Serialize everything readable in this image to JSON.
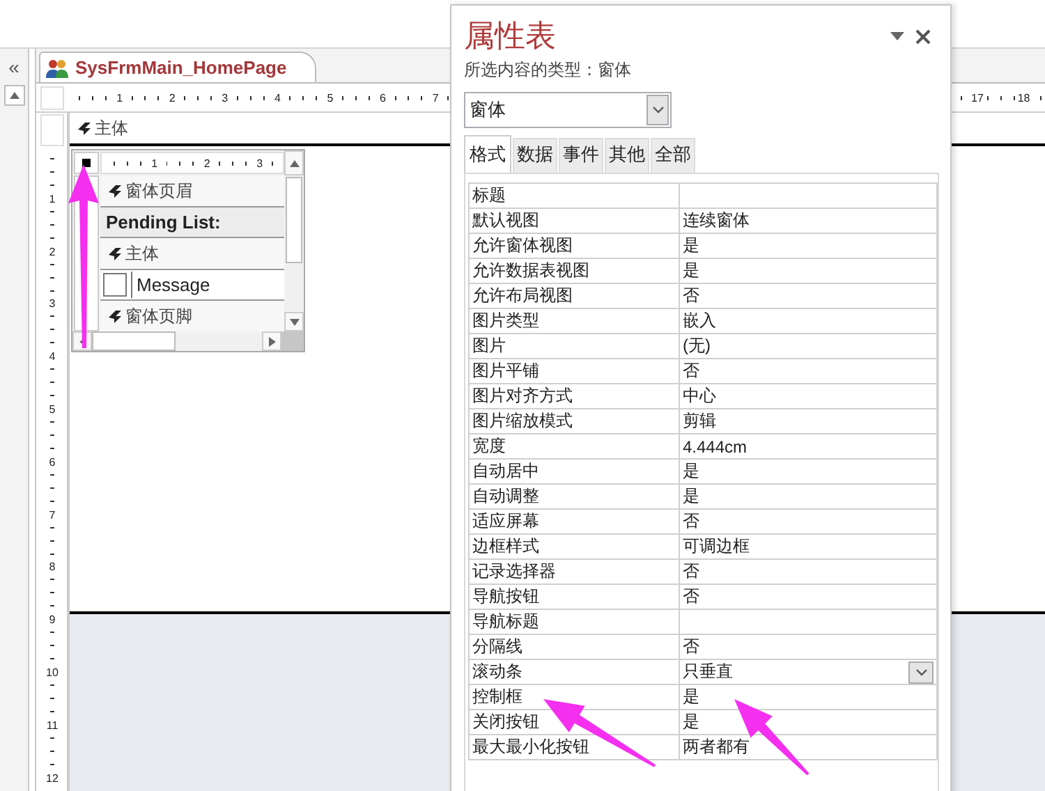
{
  "navigation_pane": {
    "collapse_glyph": "«"
  },
  "document_tab": {
    "title": "SysFrmMain_HomePage",
    "selected": true
  },
  "ruler": {
    "left_labels": [
      "1",
      "2",
      "3",
      "4",
      "5",
      "6",
      "7"
    ],
    "right_labels": [
      "17",
      "18"
    ]
  },
  "vertical_ruler": {
    "labels": [
      "1",
      "2",
      "3",
      "4",
      "5",
      "6",
      "7",
      "8",
      "9",
      "10",
      "11",
      "12"
    ]
  },
  "section": {
    "title": "主体"
  },
  "subform": {
    "ruler_labels": [
      "1",
      "2",
      "3"
    ],
    "sections": [
      {
        "kind": "header",
        "text": "窗体页眉"
      },
      {
        "kind": "label",
        "text": "Pending List:"
      },
      {
        "kind": "header",
        "text": "主体"
      },
      {
        "kind": "field",
        "text": "Message",
        "checked": false
      },
      {
        "kind": "header",
        "text": "窗体页脚"
      }
    ]
  },
  "property_sheet": {
    "title": "属性表",
    "selection_type": "所选内容的类型：窗体",
    "selector": {
      "value": "窗体"
    },
    "tabs": [
      {
        "label": "格式",
        "selected": true
      },
      {
        "label": "数据",
        "selected": false
      },
      {
        "label": "事件",
        "selected": false
      },
      {
        "label": "其他",
        "selected": false
      },
      {
        "label": "全部",
        "selected": false
      }
    ],
    "properties": [
      {
        "name": "标题",
        "selected": false
      },
      {
        "name": "默认视图",
        "value": "连续窗体",
        "selected": false
      },
      {
        "name": "允许窗体视图",
        "value": "是",
        "selected": false
      },
      {
        "name": "允许数据表视图",
        "value": "是",
        "selected": false
      },
      {
        "name": "允许布局视图",
        "value": "否",
        "selected": false
      },
      {
        "name": "图片类型",
        "value": "嵌入",
        "selected": false
      },
      {
        "name": "图片",
        "value": "(无)",
        "selected": false
      },
      {
        "name": "图片平铺",
        "value": "否",
        "selected": false
      },
      {
        "name": "图片对齐方式",
        "value": "中心",
        "selected": false
      },
      {
        "name": "图片缩放模式",
        "value": "剪辑",
        "selected": false
      },
      {
        "name": "宽度",
        "value": "4.444cm",
        "selected": false
      },
      {
        "name": "自动居中",
        "value": "是",
        "selected": false
      },
      {
        "name": "自动调整",
        "value": "是",
        "selected": false
      },
      {
        "name": "适应屏幕",
        "value": "否",
        "selected": false
      },
      {
        "name": "边框样式",
        "value": "可调边框",
        "selected": false
      },
      {
        "name": "记录选择器",
        "value": "否",
        "selected": false
      },
      {
        "name": "导航按钮",
        "value": "否",
        "selected": false
      },
      {
        "name": "导航标题",
        "selected": false
      },
      {
        "name": "分隔线",
        "value": "否",
        "selected": false
      },
      {
        "name": "滚动条",
        "value": "只垂直",
        "selected": true
      },
      {
        "name": "控制框",
        "value": "是",
        "selected": false
      },
      {
        "name": "关闭按钮",
        "value": "是",
        "selected": false
      },
      {
        "name": "最大最小化按钮",
        "value": "两者都有",
        "selected": false
      }
    ]
  }
}
